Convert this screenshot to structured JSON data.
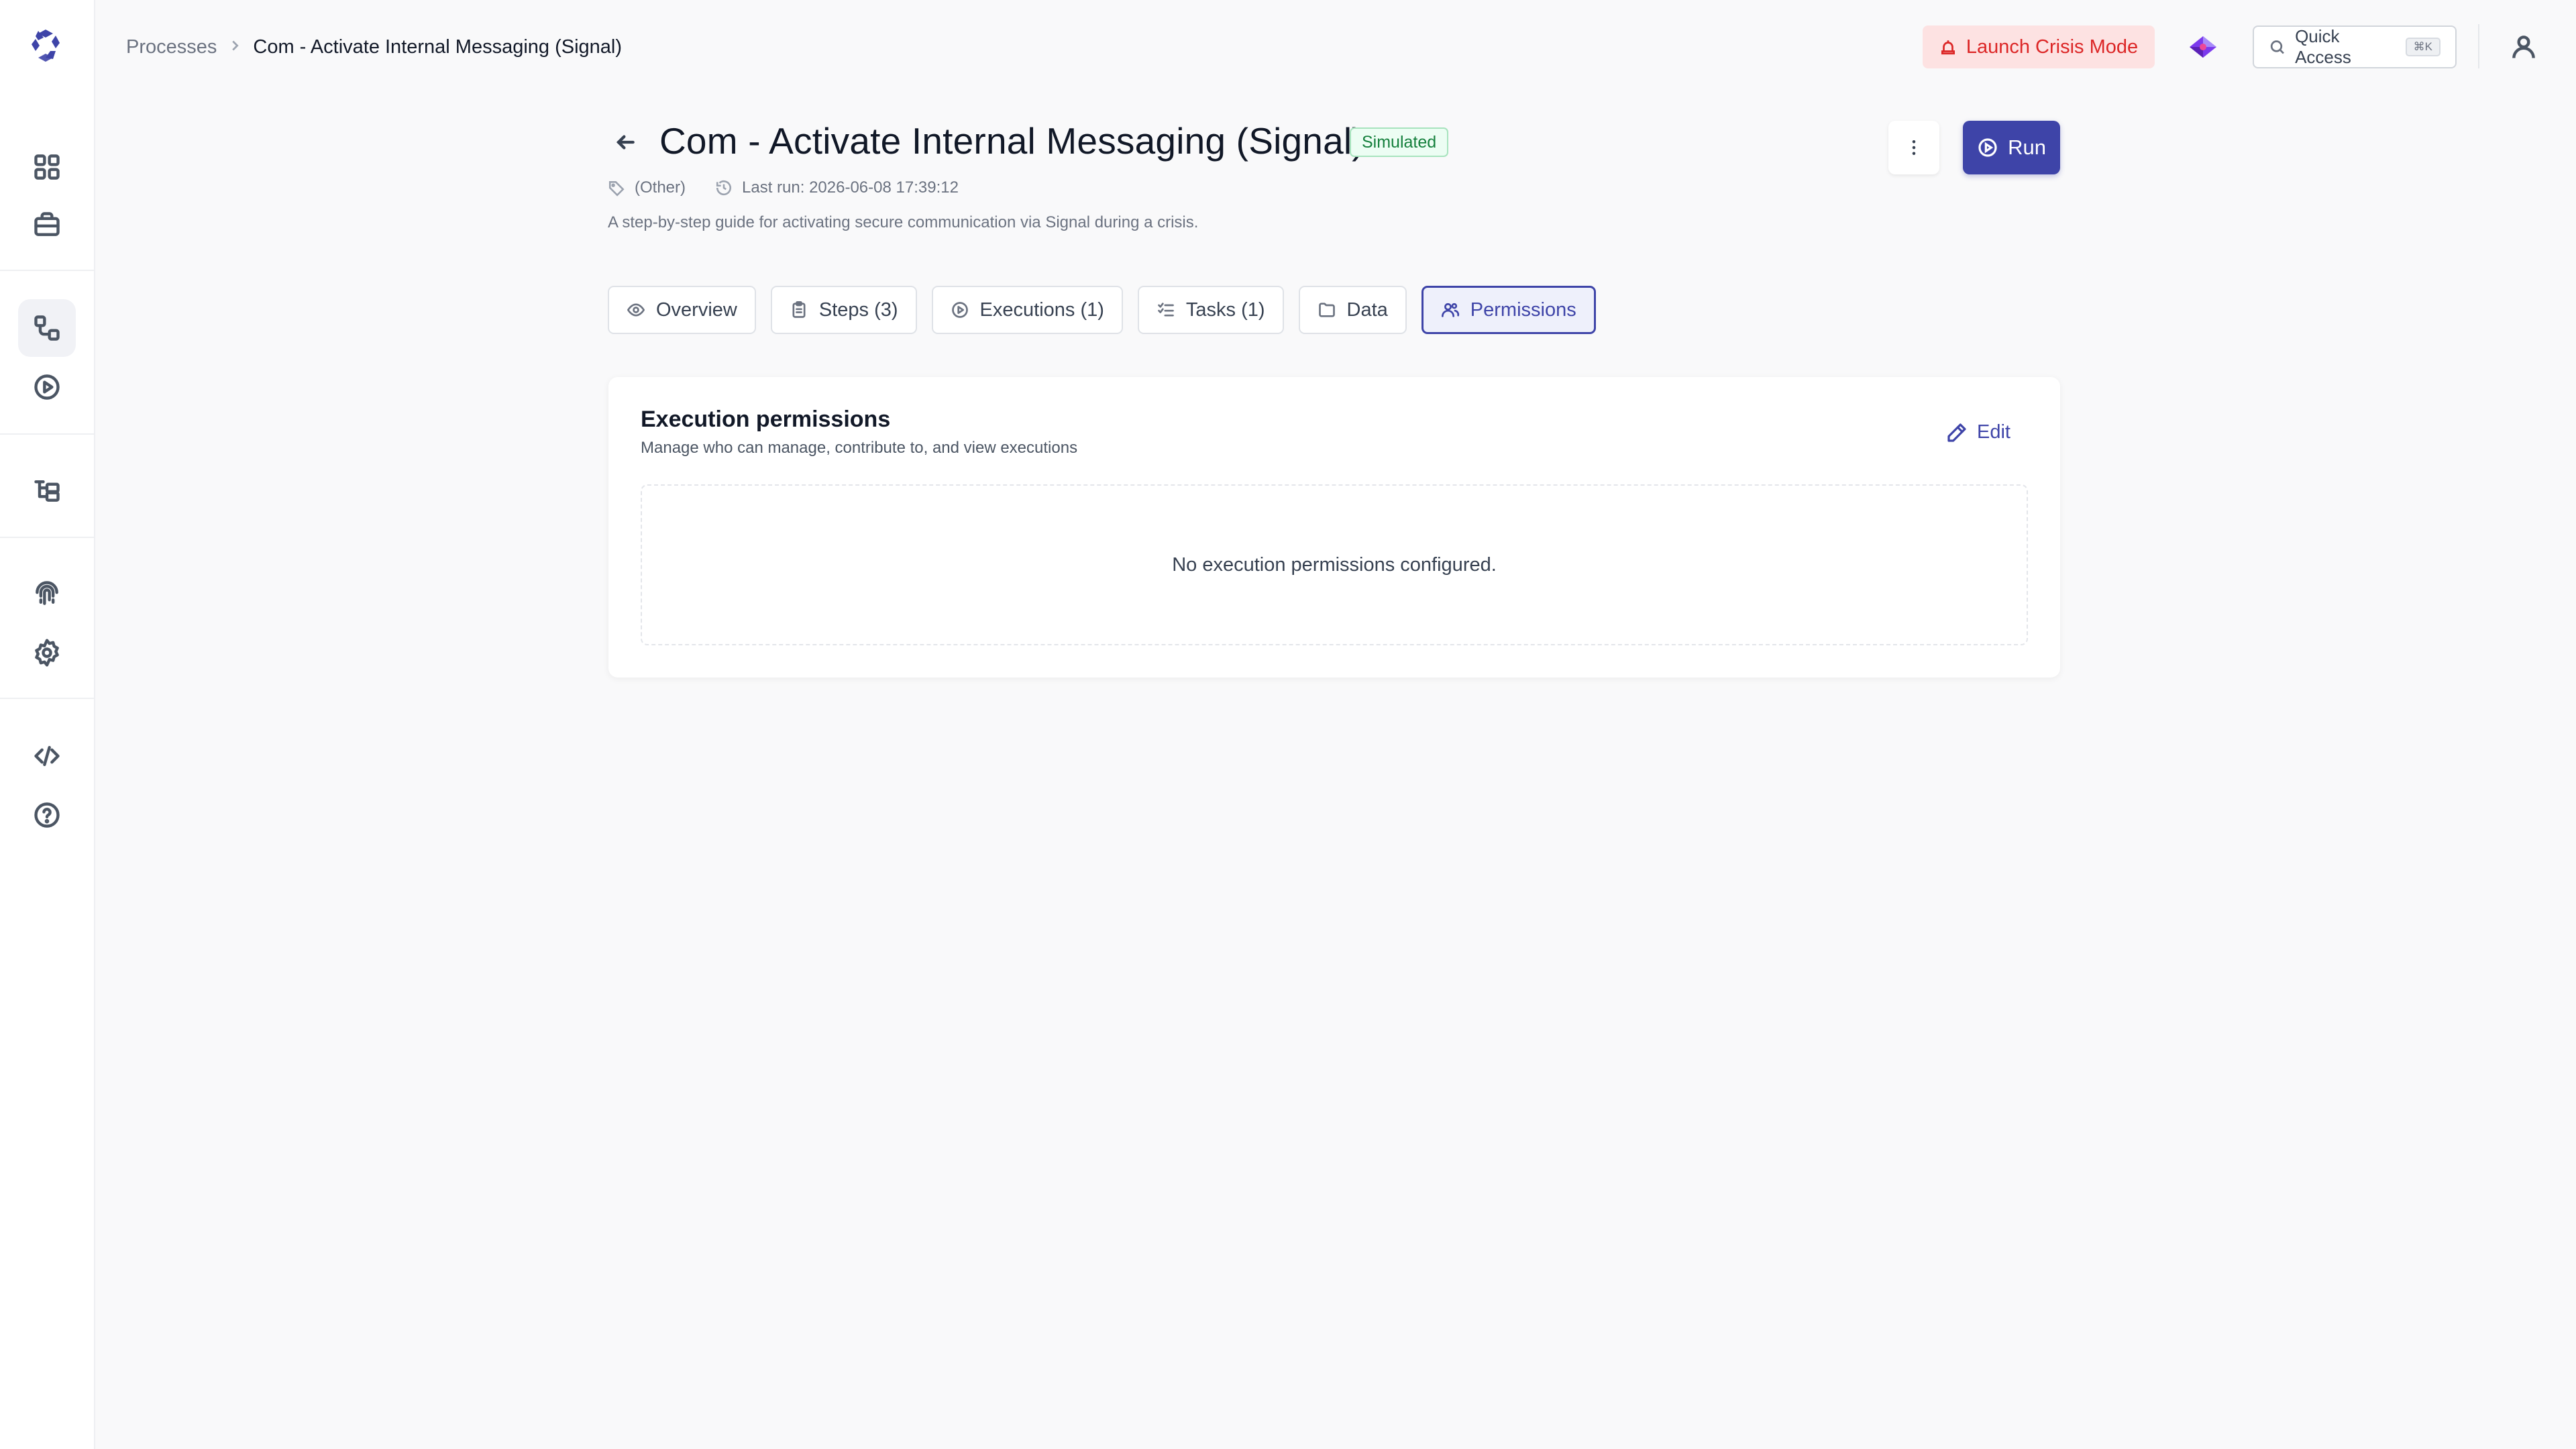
{
  "breadcrumb": {
    "parent": "Processes",
    "current": "Com - Activate Internal Messaging (Signal)"
  },
  "topbar": {
    "crisis_label": "Launch Crisis Mode",
    "quick_access_label": "Quick Access",
    "quick_access_shortcut": "⌘K"
  },
  "header": {
    "title": "Com - Activate Internal Messaging (Signal)",
    "status": "Simulated",
    "run_label": "Run",
    "category": "(Other)",
    "last_run": "Last run: 2026-06-08 17:39:12",
    "description": "A step-by-step guide for activating secure communication via Signal during a crisis."
  },
  "tabs": [
    {
      "label": "Overview",
      "icon": "eye-icon"
    },
    {
      "label": "Steps (3)",
      "icon": "clipboard-icon"
    },
    {
      "label": "Executions (1)",
      "icon": "play-circle-icon"
    },
    {
      "label": "Tasks (1)",
      "icon": "list-checks-icon"
    },
    {
      "label": "Data",
      "icon": "folder-icon"
    },
    {
      "label": "Permissions",
      "icon": "users-icon",
      "active": true
    }
  ],
  "permissions_card": {
    "title": "Execution permissions",
    "subtitle": "Manage who can manage, contribute to, and view executions",
    "edit_label": "Edit",
    "empty_message": "No execution permissions configured."
  },
  "sidebar": {
    "items": [
      {
        "name": "dashboard",
        "icon": "grid-icon"
      },
      {
        "name": "briefcase",
        "icon": "briefcase-icon"
      },
      {
        "name": "processes",
        "icon": "workflow-icon",
        "active": true
      },
      {
        "name": "executions",
        "icon": "play-circle-icon"
      },
      {
        "name": "structure",
        "icon": "tree-icon"
      },
      {
        "name": "fingerprint",
        "icon": "fingerprint-icon"
      },
      {
        "name": "settings",
        "icon": "gear-icon"
      },
      {
        "name": "developer",
        "icon": "code-icon"
      },
      {
        "name": "help",
        "icon": "help-circle-icon"
      }
    ]
  },
  "colors": {
    "accent": "#3e44a8",
    "crisis_bg": "#fde2e2",
    "crisis_text": "#dc2626",
    "success_text": "#15803d",
    "page_bg": "#f9f9fa"
  }
}
